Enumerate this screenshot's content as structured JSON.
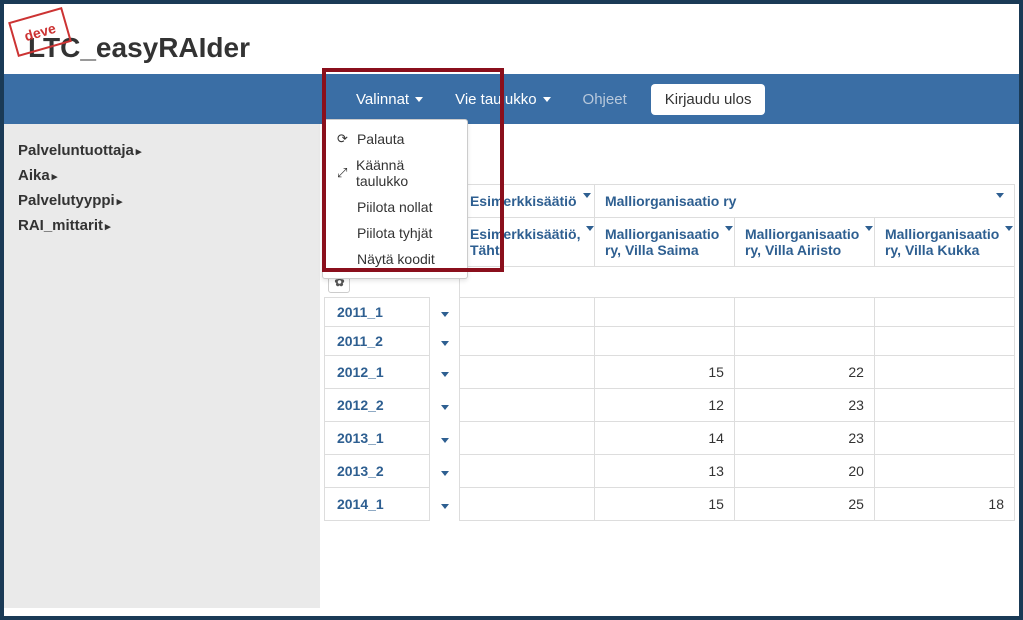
{
  "badge": "deve",
  "app_title": "LTC_easyRAIder",
  "navbar": {
    "valinnat": "Valinnat",
    "vie_taulukko": "Vie taulukko",
    "ohjeet": "Ohjeet",
    "kirjaudu_ulos": "Kirjaudu ulos"
  },
  "dropdown": {
    "palauta": "Palauta",
    "kaanna": "Käännä taulukko",
    "piilota_nollat": "Piilota nollat",
    "piilota_tyhjat": "Piilota tyhjät",
    "nayta_koodit": "Näytä koodit"
  },
  "sidebar": {
    "items": [
      "Palveluntuottaja",
      "Aika",
      "Palvelutyyppi",
      "RAI_mittarit"
    ]
  },
  "table": {
    "group_headers": [
      "Esimerkkisäätiö",
      "Malliorganisaatio ry"
    ],
    "col_headers": [
      "Esimerkkisäätiö, Tähti",
      "Malliorganisaatio ry, Villa Saima",
      "Malliorganisaatio ry, Villa Airisto",
      "Malliorganisaatio ry, Villa Kukka"
    ],
    "rows": [
      {
        "label": "2011_1",
        "vals": [
          "",
          "",
          "",
          ""
        ]
      },
      {
        "label": "2011_2",
        "vals": [
          "",
          "",
          "",
          ""
        ]
      },
      {
        "label": "2012_1",
        "vals": [
          "",
          "15",
          "22",
          ""
        ]
      },
      {
        "label": "2012_2",
        "vals": [
          "",
          "12",
          "23",
          ""
        ]
      },
      {
        "label": "2013_1",
        "vals": [
          "",
          "14",
          "23",
          ""
        ]
      },
      {
        "label": "2013_2",
        "vals": [
          "",
          "13",
          "20",
          ""
        ]
      },
      {
        "label": "2014_1",
        "vals": [
          "",
          "15",
          "25",
          "18"
        ]
      }
    ]
  }
}
